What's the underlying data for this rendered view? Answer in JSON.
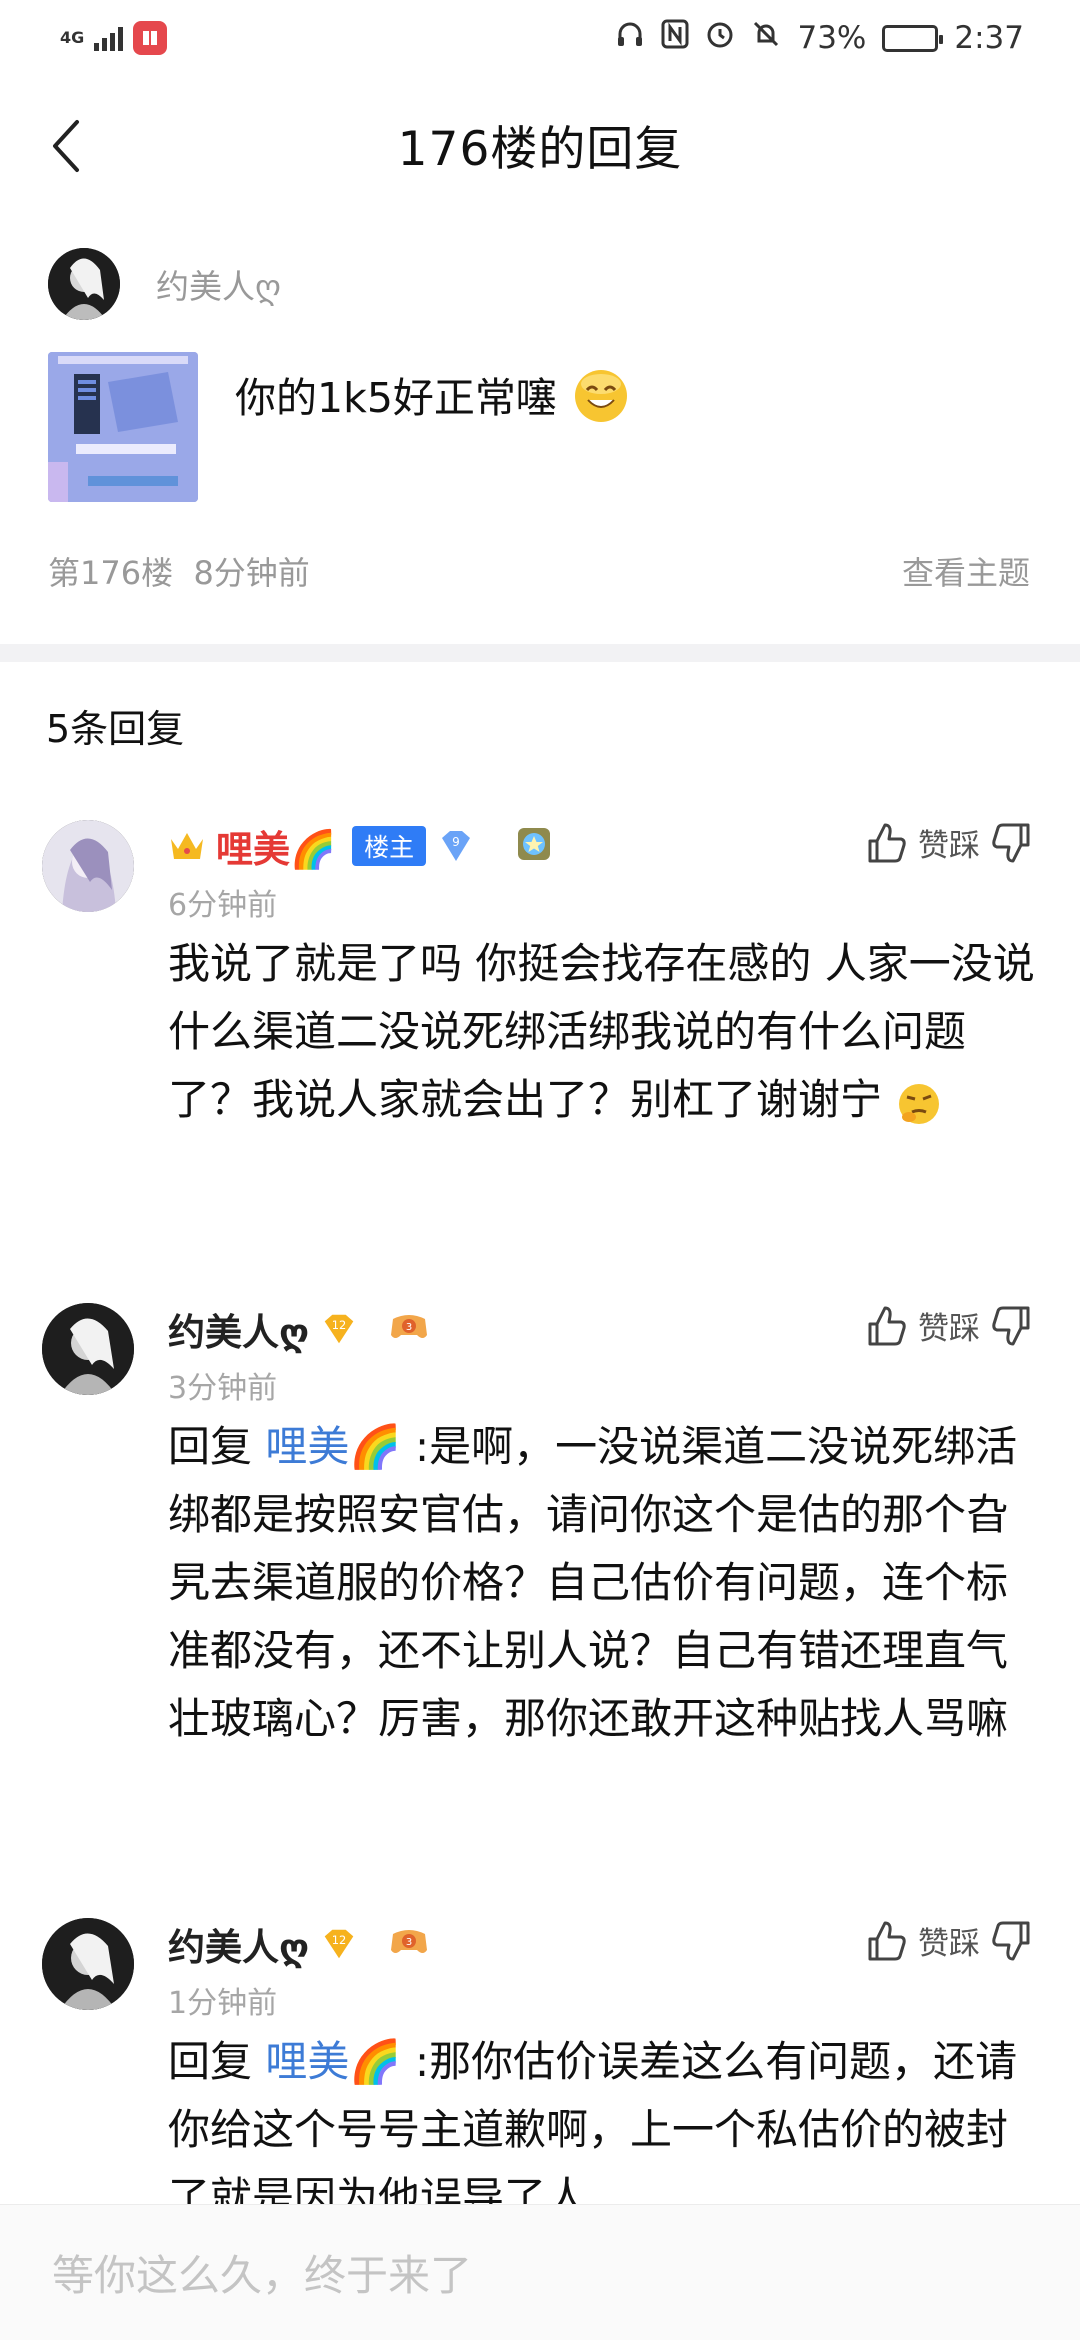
{
  "status_bar": {
    "network": "4G",
    "battery": "73%",
    "battery_level": 0.73,
    "time": "2:37"
  },
  "header": {
    "title": "176楼的回复",
    "back_icon": "chevron-left-icon"
  },
  "post": {
    "author": "约美人ღ",
    "text": "你的1k5好正常噻",
    "floor": "第176楼",
    "time": "8分钟前",
    "view_topic": "查看主题"
  },
  "reply_count": "5条回复",
  "replies": [
    {
      "name": "哩美🌈",
      "owner_badge": "楼主",
      "level": "9",
      "time": "6分钟前",
      "vote_label": "赞踩",
      "body": "我说了就是了吗 你挺会找存在感的 人家一没说什么渠道二没说死绑活绑我说的有什么问题了？我说人家就会出了？别杠了谢谢宁"
    },
    {
      "name": "约美人ღ",
      "level": "12",
      "time": "3分钟前",
      "vote_label": "赞踩",
      "reply_prefix": "回复",
      "mention": "哩美🌈",
      "body": " :是啊，一没说渠道二没说死绑活绑都是按照安官估，请问你这个是估的那个旮旯去渠道服的价格？自己估价有问题，连个标准都没有，还不让别人说？自己有错还理直气壮玻璃心？厉害，那你还敢开这种贴找人骂嘛"
    },
    {
      "name": "约美人ღ",
      "level": "12",
      "time": "1分钟前",
      "vote_label": "赞踩",
      "reply_prefix": "回复",
      "mention": "哩美🌈",
      "body": " :那你估价误差这么有问题，还请你给这个号号主道歉啊，上一个私估价的被封了就是因为他误导了人"
    }
  ],
  "input": {
    "placeholder": "等你这么久，终于来了"
  },
  "colors": {
    "mention": "#3d7bd6",
    "owner_badge": "#2f7cf6",
    "owner_name": "#e53935"
  }
}
